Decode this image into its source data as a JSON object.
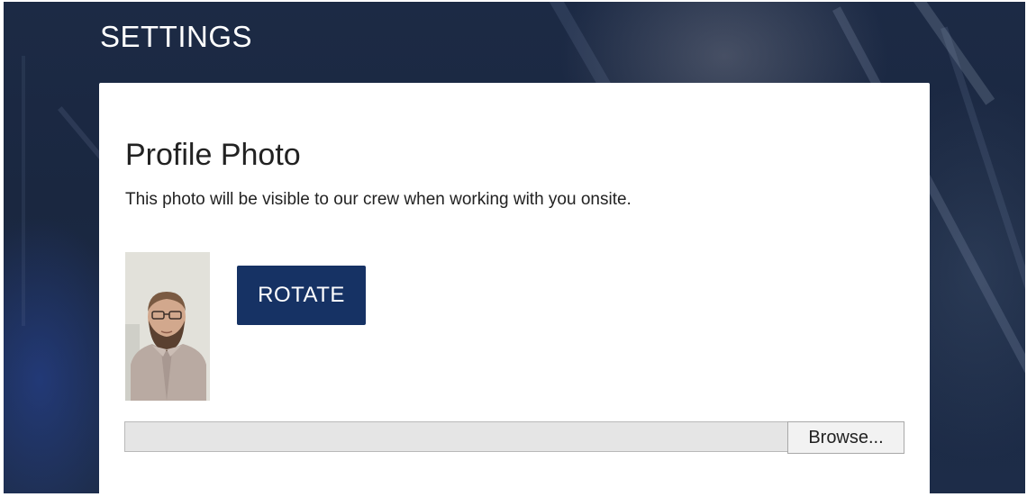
{
  "header": {
    "title": "SETTINGS"
  },
  "profile_photo": {
    "title": "Profile Photo",
    "description": "This photo will be visible to our crew when working with you onsite.",
    "photo_alt": "Profile photo of a bearded man wearing glasses",
    "rotate_label": "ROTATE"
  },
  "file_upload": {
    "value": "",
    "browse_label": "Browse..."
  },
  "colors": {
    "header_background": "#1b2842",
    "button_primary": "#163264",
    "card_background": "#ffffff"
  }
}
